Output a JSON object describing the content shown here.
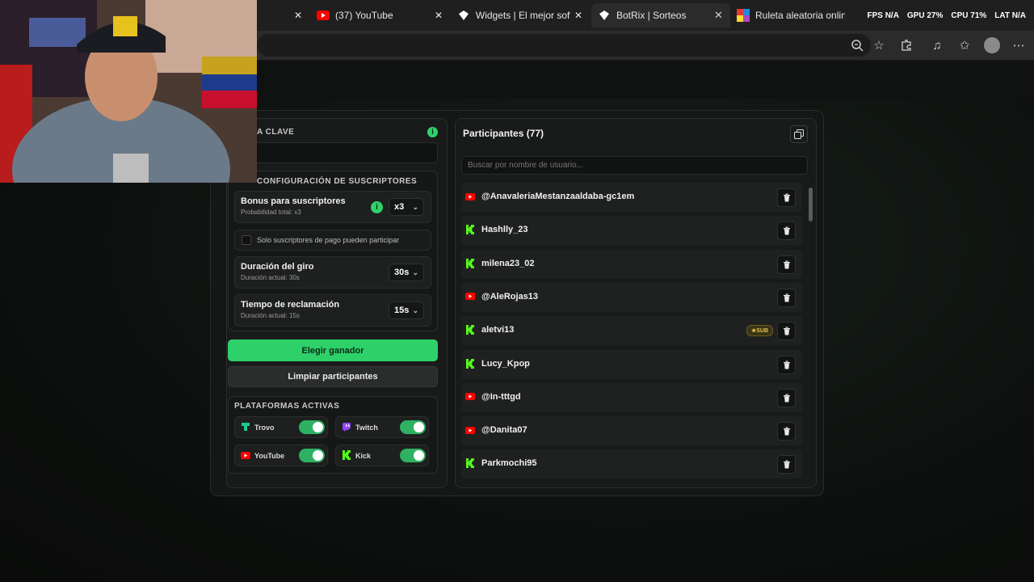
{
  "browser": {
    "tabs": [
      {
        "label": "(37) YouTube",
        "icon": "youtube-icon"
      },
      {
        "label": "Widgets | El mejor softw",
        "icon": "botrix-icon"
      },
      {
        "label": "BotRix | Sorteos",
        "icon": "botrix-icon",
        "active": true
      },
      {
        "label": "Ruleta aleatoria online",
        "icon": "wheel-icon"
      }
    ],
    "overlay": {
      "fps": "FPS N/A",
      "gpu": "GPU 27%",
      "cpu": "CPU 71%",
      "lat": "LAT N/A"
    }
  },
  "left": {
    "keyword_title": "A CLAVE",
    "subs_title": "CONFIGURACIÓN DE SUSCRIPTORES",
    "bonus": {
      "title": "Bonus para suscriptores",
      "subtitle": "Probabilidad total: x3",
      "value": "x3"
    },
    "paid_only_label": "Solo suscriptores de pago pueden participar",
    "spin": {
      "title": "Duración del giro",
      "subtitle": "Duración actual: 30s",
      "value": "30s"
    },
    "claim": {
      "title": "Tiempo de reclamación",
      "subtitle": "Duración actual: 15s",
      "value": "15s"
    },
    "choose_winner": "Elegir ganador",
    "clear_participants": "Limpiar participantes",
    "platforms_title": "PLATAFORMAS ACTIVAS",
    "platforms": [
      {
        "name": "Trovo",
        "on": true,
        "color": "#1bc98e"
      },
      {
        "name": "Twitch",
        "on": true,
        "color": "#9146ff"
      },
      {
        "name": "YouTube",
        "on": true,
        "color": "#ff0000"
      },
      {
        "name": "Kick",
        "on": true,
        "color": "#53fc18"
      }
    ]
  },
  "right": {
    "title": "Participantes (77)",
    "search_placeholder": "Buscar por nombre de usuario...",
    "participants": [
      {
        "name": "@AnavaleriaMestanzaaldaba-gc1em",
        "platform": "youtube"
      },
      {
        "name": "Hashlly_23",
        "platform": "kick"
      },
      {
        "name": "milena23_02",
        "platform": "kick"
      },
      {
        "name": "@AleRojas13",
        "platform": "youtube"
      },
      {
        "name": "aletvi13",
        "platform": "kick",
        "badge": "SUB"
      },
      {
        "name": "Lucy_Kpop",
        "platform": "kick"
      },
      {
        "name": "@In-tttgd",
        "platform": "youtube"
      },
      {
        "name": "@Danita07",
        "platform": "youtube"
      },
      {
        "name": "Parkmochi95",
        "platform": "kick"
      }
    ]
  },
  "colors": {
    "accent": "#2ed06a",
    "youtube": "#ff0000",
    "kick": "#53fc18"
  }
}
